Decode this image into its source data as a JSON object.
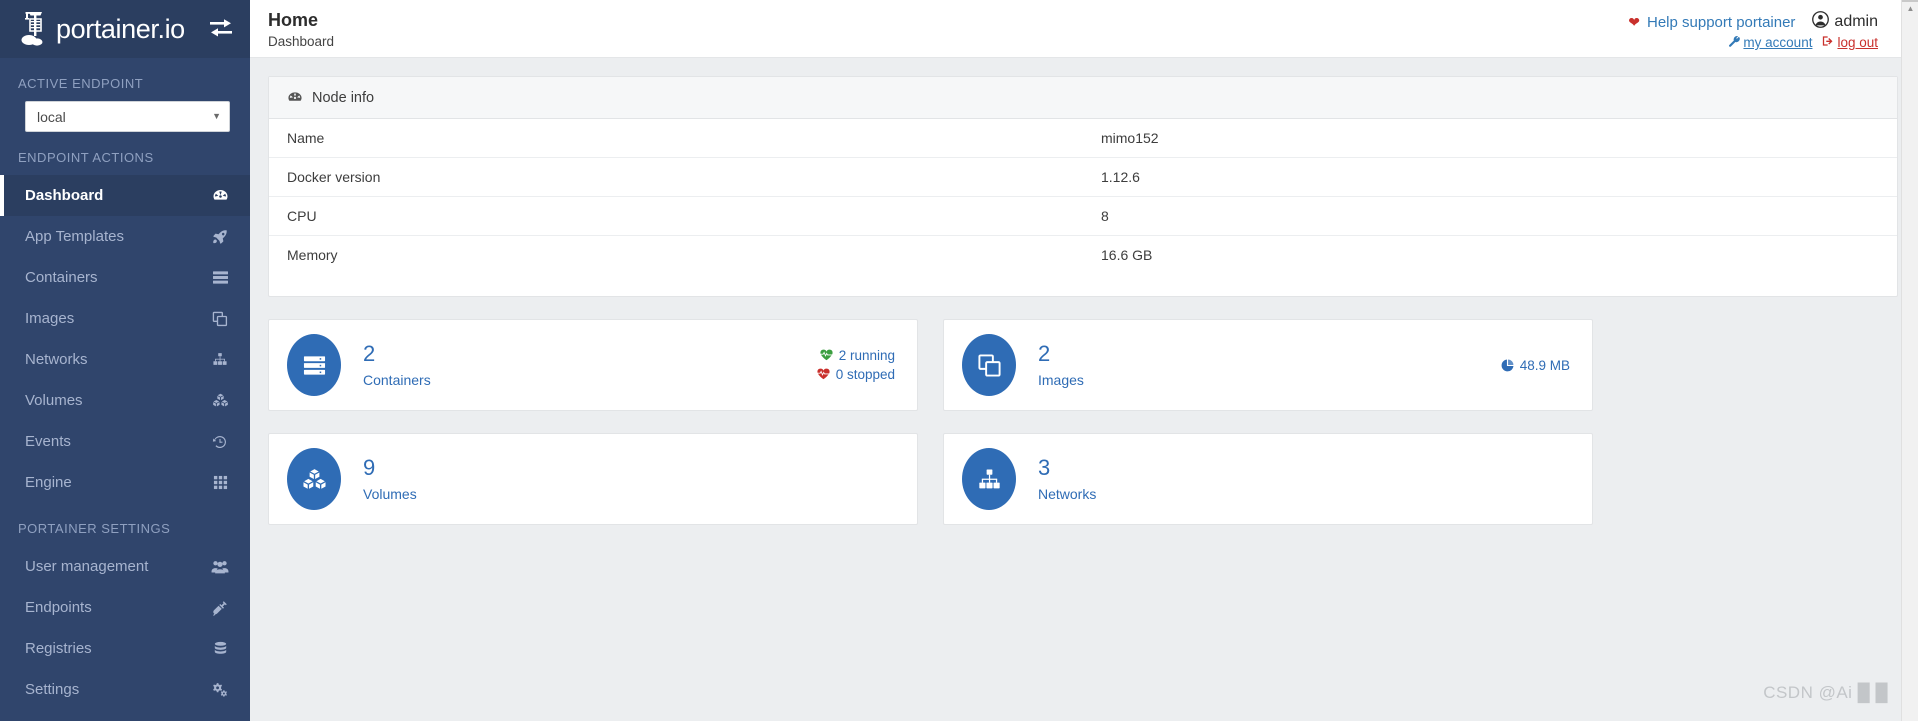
{
  "brand": {
    "name": "portainer.io",
    "logo_icon": "portainer-crane-logo",
    "switch_icon": "endpoint-switch-icon"
  },
  "sidebar": {
    "active_endpoint_heading": "ACTIVE ENDPOINT",
    "endpoint_selected": "local",
    "endpoint_caret": "▼",
    "endpoint_actions_heading": "ENDPOINT ACTIONS",
    "portainer_settings_heading": "PORTAINER SETTINGS",
    "endpoint_actions": [
      {
        "label": "Dashboard",
        "icon": "dashboard-gauge-icon",
        "active": true
      },
      {
        "label": "App Templates",
        "icon": "rocket-icon",
        "active": false
      },
      {
        "label": "Containers",
        "icon": "containers-list-icon",
        "active": false
      },
      {
        "label": "Images",
        "icon": "images-clone-icon",
        "active": false
      },
      {
        "label": "Networks",
        "icon": "sitemap-icon",
        "active": false
      },
      {
        "label": "Volumes",
        "icon": "cubes-icon",
        "active": false
      },
      {
        "label": "Events",
        "icon": "history-clock-icon",
        "active": false
      },
      {
        "label": "Engine",
        "icon": "grid-th-icon",
        "active": false
      }
    ],
    "portainer_settings": [
      {
        "label": "User management",
        "icon": "users-icon",
        "active": false
      },
      {
        "label": "Endpoints",
        "icon": "plug-icon",
        "active": false
      },
      {
        "label": "Registries",
        "icon": "database-stack-icon",
        "active": false
      },
      {
        "label": "Settings",
        "icon": "cogs-icon",
        "active": false
      }
    ]
  },
  "header": {
    "title": "Home",
    "breadcrumb": "Dashboard",
    "help_link": "Help support portainer",
    "heart_icon": "heart-icon",
    "user_name": "admin",
    "user_icon": "user-circle-icon",
    "my_account_label": "my account",
    "my_account_icon": "wrench-icon",
    "logout_label": "log out",
    "logout_icon": "sign-out-icon"
  },
  "node_info": {
    "panel_title": "Node info",
    "panel_icon": "tachometer-icon",
    "rows": [
      {
        "label": "Name",
        "value": "mimo152"
      },
      {
        "label": "Docker version",
        "value": "1.12.6"
      },
      {
        "label": "CPU",
        "value": "8"
      },
      {
        "label": "Memory",
        "value": "16.6 GB"
      }
    ]
  },
  "stat_cards": [
    {
      "value": "2",
      "label": "Containers",
      "icon": "containers-list-icon",
      "meta": [
        {
          "text": "2 running",
          "icon": "heartbeat-icon",
          "status_color": "#3c9f40"
        },
        {
          "text": "0 stopped",
          "icon": "heartbeat-icon",
          "status_color": "#c9302c"
        }
      ]
    },
    {
      "value": "2",
      "label": "Images",
      "icon": "images-clone-icon",
      "meta": [
        {
          "text": "48.9 MB",
          "icon": "pie-chart-icon",
          "status_color": "#2f6cb5"
        }
      ]
    },
    {
      "value": "9",
      "label": "Volumes",
      "icon": "cubes-icon",
      "meta": []
    },
    {
      "value": "3",
      "label": "Networks",
      "icon": "sitemap-icon",
      "meta": []
    }
  ],
  "scrollbar": {
    "up_arrow": "▲"
  },
  "watermark": "CSDN @Ai █ █",
  "colors": {
    "sidebar_bg": "#30456c",
    "sidebar_dark": "#2b3e60",
    "accent_blue": "#2f6cb5",
    "link_blue": "#337ab7",
    "danger_red": "#c9302c",
    "success_green": "#3c9f40",
    "page_bg": "#eceef0"
  }
}
